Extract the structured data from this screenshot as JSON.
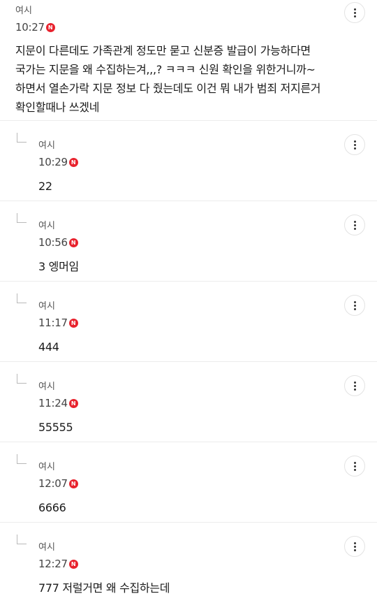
{
  "comments": [
    {
      "author": "여시",
      "time": "10:27",
      "badge": "N",
      "lines": [
        "지문이 다른데도 가족관계 정도만 묻고 신분증 발급이 가능하다면",
        "국가는 지문을 왜 수집하는겨,,,? ㅋㅋㅋ 신원 확인을 위한거니까~",
        "하면서 열손가락 지문 정보 다 줬는데도 이건 뭐 내가 범죄 저지른거",
        "확인할때나 쓰겠네"
      ]
    }
  ],
  "replies": [
    {
      "author": "여시",
      "time": "10:29",
      "badge": "N",
      "text": "22"
    },
    {
      "author": "여시",
      "time": "10:56",
      "badge": "N",
      "text": "3 엥머임"
    },
    {
      "author": "여시",
      "time": "11:17",
      "badge": "N",
      "text": "444"
    },
    {
      "author": "여시",
      "time": "11:24",
      "badge": "N",
      "text": "55555"
    },
    {
      "author": "여시",
      "time": "12:07",
      "badge": "N",
      "text": "6666"
    },
    {
      "author": "여시",
      "time": "12:27",
      "badge": "N",
      "text": "777 저럴거면 왜 수집하는데"
    }
  ],
  "icons": {
    "more": "more-vertical-icon",
    "new_badge": "new-badge-icon",
    "reply": "reply-arrow-icon"
  },
  "colors": {
    "badge": "#e8232e",
    "divider": "#ececec"
  }
}
